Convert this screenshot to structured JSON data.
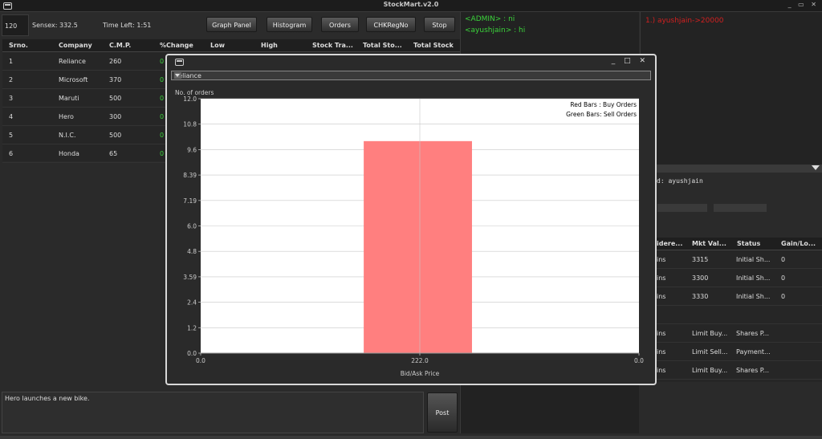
{
  "app": {
    "title": "StockMart.v2.0"
  },
  "toolbar": {
    "field_value": "120",
    "sensex": "Sensex: 332.5",
    "time_left": "Time Left: 1:51",
    "buttons": [
      "Graph Panel",
      "Histogram",
      "Orders",
      "CHKRegNo",
      "Stop"
    ]
  },
  "stock_table": {
    "headers": [
      "Srno.",
      "Company",
      "C.M.P.",
      "%Change",
      "Low",
      "High",
      "Stock Tra...",
      "Total Sto...",
      "Total Stock"
    ],
    "rows": [
      {
        "srno": "1",
        "company": "Reliance",
        "cmp": "260",
        "change": "0"
      },
      {
        "srno": "2",
        "company": "Microsoft",
        "cmp": "370",
        "change": "0"
      },
      {
        "srno": "3",
        "company": "Maruti",
        "cmp": "500",
        "change": "0"
      },
      {
        "srno": "4",
        "company": "Hero",
        "cmp": "300",
        "change": "0"
      },
      {
        "srno": "5",
        "company": "N.I.C.",
        "cmp": "500",
        "change": "0"
      },
      {
        "srno": "6",
        "company": "Honda",
        "cmp": "65",
        "change": "0"
      }
    ]
  },
  "chat": {
    "lines": [
      "<ADMIN> : ni",
      "<ayushjain> : hi"
    ]
  },
  "right_panel": {
    "line": "1.) ayushjain->20000",
    "user_text": "d: ayushjain",
    "table_headers": [
      "idere...",
      "Mkt Val...",
      "Status",
      "Gain/Lo..."
    ],
    "rows": [
      {
        "a": "ins",
        "b": "3315",
        "c": "Initial Sh...",
        "d": "0"
      },
      {
        "a": "ins",
        "b": "3300",
        "c": "Initial Sh...",
        "d": "0"
      },
      {
        "a": "ins",
        "b": "3330",
        "c": "Initial Sh...",
        "d": "0"
      },
      {
        "a": "",
        "b": "",
        "c": "",
        "d": ""
      },
      {
        "a": "ins",
        "b": "Limit Buy...",
        "c": "Shares P...",
        "d": ""
      },
      {
        "a": "ins",
        "b": "Limit Sell...",
        "c": "Payment...",
        "d": ""
      },
      {
        "a": "ins",
        "b": "Limit Buy...",
        "c": "Shares P...",
        "d": ""
      }
    ]
  },
  "news": {
    "text": "Hero launches a new bike.",
    "post_label": "Post"
  },
  "dialog": {
    "selected": "Reliance",
    "controls": "_ □ ✕"
  },
  "window_controls": "_ ▭ ✕",
  "chart_data": {
    "type": "bar",
    "ylabel": "No. of orders",
    "xlabel": "Bid/Ask Price",
    "ylim": [
      0,
      12.0
    ],
    "y_ticks": [
      "0.0",
      "1.2",
      "2.4",
      "3.59",
      "4.8",
      "6.0",
      "7.19",
      "8.39",
      "9.6",
      "10.8",
      "12.0"
    ],
    "x_ticks": [
      "0.0",
      "222.0",
      "0.0"
    ],
    "series": [
      {
        "name": "Buy Orders",
        "color": "#ff7f7f",
        "categories": [
          "222.0"
        ],
        "values": [
          10.0
        ]
      }
    ],
    "legend": [
      "Red Bars   : Buy Orders",
      "Green Bars: Sell Orders"
    ],
    "legend_position": "top-right",
    "grid": true
  }
}
